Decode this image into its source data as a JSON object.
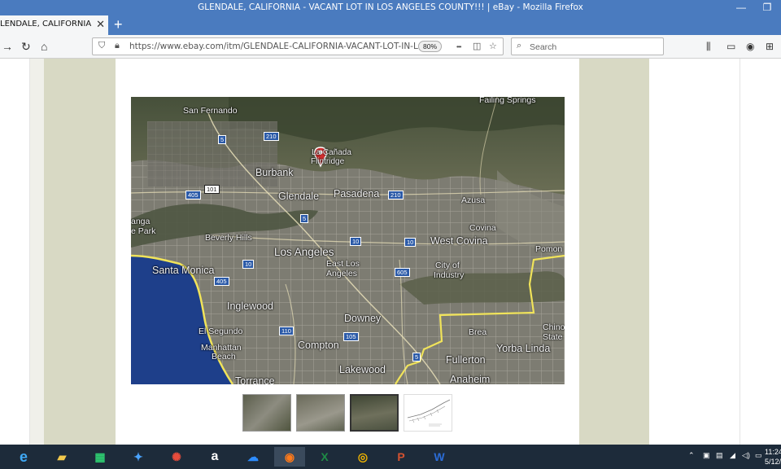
{
  "window": {
    "title": "GLENDALE, CALIFORNIA - VACANT LOT IN LOS ANGELES COUNTY!!! | eBay - Mozilla Firefox",
    "minimize_glyph": "—",
    "restore_glyph": "❐"
  },
  "tab": {
    "label": "LENDALE, CALIFORNIA - VAC",
    "close_glyph": "✕"
  },
  "toolbar": {
    "new_tab_glyph": "+",
    "url": "https://www.ebay.com/itm/GLENDALE-CALIFORNIA-VACANT-LOT-IN-LOS",
    "zoom": "80%",
    "search_placeholder": "Search",
    "more_glyph": "•••"
  },
  "map": {
    "labels": [
      "San Fernando",
      "Failing Springs",
      "La Cañada",
      "Flintridge",
      "Burbank",
      "Glendale",
      "Pasadena",
      "Azusa",
      "Covina",
      "West Covina",
      "Beverly Hills",
      "Los Angeles",
      "East Los",
      "Angeles",
      "City of",
      "Industry",
      "Santa Monica",
      "Inglewood",
      "Downey",
      "El Segundo",
      "Manhattan",
      "Beach",
      "Compton",
      "Brea",
      "Chino",
      "State",
      "Fullerton",
      "Yorba Linda",
      "Lakewood",
      "Anaheim",
      "Torrance",
      "Pomon",
      "anga",
      "e Park"
    ],
    "shields": [
      "5",
      "210",
      "405",
      "101",
      "210",
      "10",
      "10",
      "10",
      "405",
      "605",
      "110",
      "105",
      "5",
      "5"
    ]
  },
  "thumbnails": [
    "map-view-1",
    "map-view-2",
    "map-view-3",
    "parcel-plat"
  ],
  "taskbar": {
    "apps": [
      "Internet Explorer",
      "File Explorer",
      "Store",
      "Dropbox",
      "Paint",
      "Amazon",
      "OneDrive",
      "Firefox",
      "Excel",
      "Chrome",
      "PowerPoint",
      "Word"
    ],
    "clock_time": "11:24",
    "clock_date": "5/12/"
  },
  "colors": {
    "titlebar": "#4a7bbf",
    "page_side_panel": "#d8d9c4",
    "taskbar": "#1d2b3a"
  }
}
